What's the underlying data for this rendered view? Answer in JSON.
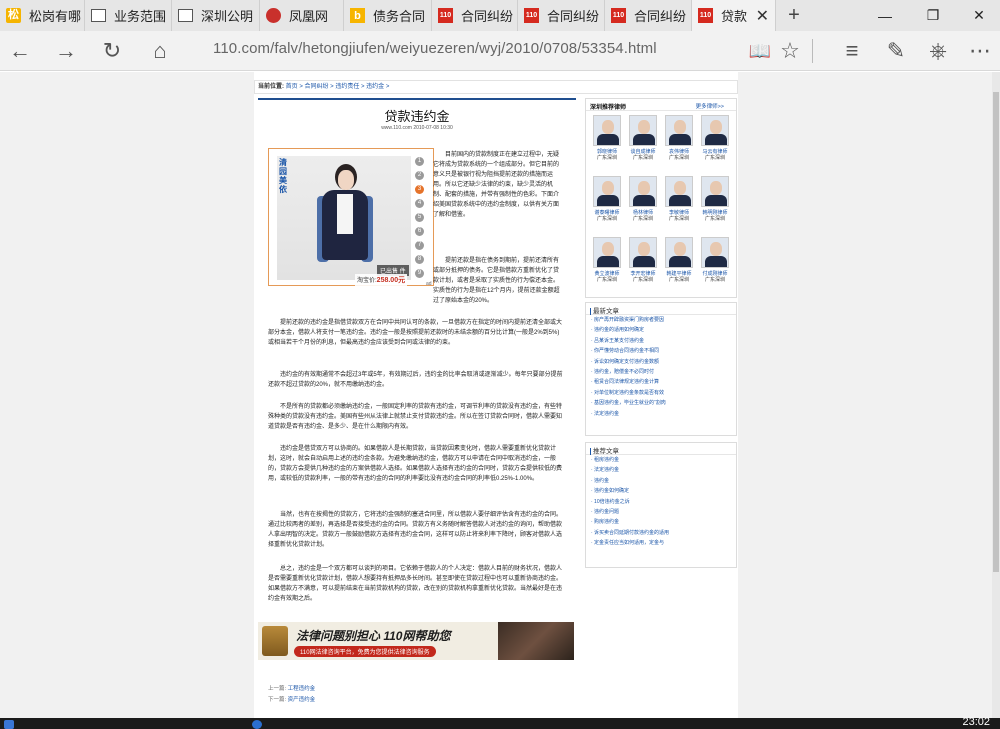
{
  "tabs": [
    {
      "title": "松岗有哪",
      "favicon": "orange-square"
    },
    {
      "title": "业务范围",
      "favicon": "page"
    },
    {
      "title": "深圳公明",
      "favicon": "page"
    },
    {
      "title": "凤凰网",
      "favicon": "phoenix"
    },
    {
      "title": "债务合同",
      "favicon": "bing"
    },
    {
      "title": "合同纠纷",
      "favicon": "110"
    },
    {
      "title": "合同纠纷",
      "favicon": "110"
    },
    {
      "title": "合同纠纷",
      "favicon": "110"
    },
    {
      "title": "贷款",
      "favicon": "110",
      "active": true
    }
  ],
  "favicon_text": {
    "orange": "松",
    "bing": "b",
    "site": "110"
  },
  "address": "110.com/falv/hetongjiufen/weiyuezeren/wyj/2010/0708/53354.html",
  "breadcrumb": {
    "label": "当前位置:",
    "path": "首页 > 合同纠纷 > 违约责任 > 违约金 >"
  },
  "article": {
    "title": "贷款违约金",
    "meta": "www.110.com 2010-07-08 10:30",
    "ad": {
      "vertical_text": "清园美依",
      "sold": "已出售 件",
      "price_label": "淘宝价:",
      "price": "258.00元",
      "numbers": [
        "1",
        "2",
        "3",
        "4",
        "5",
        "6",
        "7",
        "8",
        "9"
      ],
      "active_index": 2,
      "corner": "ad"
    },
    "paragraphs": [
      "目前国内的贷款制度正在建立过程中，无疑它将成为贷款系统的一个组成部分。但它目前的意义只是被银行视为阻挡提前还款的措施而运用。所以它还缺少法律的约束，缺少灵活的机制、配套的措施，并带有强制性的色彩。下面介绍美国贷款系统中的违约金制度，以供有关方面了解和借鉴。",
      "提前还款是指在债务到期前，提前还清所有或部分抵押的债务。它是指借款方重新优化了贷款计划，或者是采取了实质性的行为偿还本金。实质性的行为是指在12个月内，提前还款金额超过了原始本金的20%。",
      "提前还款的违约金是指借贷款双方在合同中共同认可的条款，一旦借款方在指定的时间内提前还清全部或大部分本金，借款人将支付一笔违约金。违约金一般是按照提前还款时的未结余额的百分比计算(一般是2%到5%)或相当若干个月份的利息，但最高违约金应该受到合同或法律的约束。",
      "违约金的有效期通常不会超过3年或5年，有效期过后，违约金的比率会取消或逐渐减少。每年只要部分提前还款不超过贷款的20%，就不用缴纳违约金。",
      "不是所有的贷款都必须缴纳违约金，一般固定利率的贷款有违约金，可调节利率的贷款没有违约金，有些特殊种类的贷款没有违约金。美国有些州从法律上就禁止支付贷款违约金。所以在签订贷款合同时，借款人需要知道贷款是否有违约金、是多少、是在什么期限内有效。",
      "违约金是借贷双方可以协商的。如果借款人是长期贷款，当贷款因素变化时，借款人需要重新优化贷款计划，这时，就会自动启用上述的违约金条款。为避免缴纳违约金，借款方可以申请在合同中取消违约金，一般的，贷款方会提供几种违约金的方案供借款人选择。如果借款人选择有违约金的合同时，贷款方会提供较低的费用，或较低的贷款利率，一般的带有违约金的合同的利率要比没有违约金合同的利率低0.25%-1.00%。",
      "当然，也有在按揭性的贷款方，它将违约金强制的塞进合同里，所以借款人要仔细评估含有违约金的合同。通过比较两者的差别，再选择是否接受违约金的合同。贷款方有义务随时解答借款人对违约金的询问，帮助借款人拿出明智的决定。贷款方一般鼓励借款方选择有违约金合同，这样可以防止将来利率下降时，顾客对借款人选择重新优化贷款计划。",
      "总之，违约金是一个双方都可以谈判的项目。它依赖于借款人的个人决定：借款人目前的财务状况，借款人是否需要重新优化贷款计划，借款人想要持有抵押品多长时间。甚至即使在贷款过程中也可以重新协商违约金。如果借款方不满意，可以提前结束在当前贷款机构的贷款，改在别的贷款机构拿重新优化贷款。当然最好是在违约金有效期之后。"
    ]
  },
  "banner": {
    "title": "法律问题别担心 110网帮助您",
    "subtitle": "110网法律咨询平台，免费为您提供法律咨询服务"
  },
  "prevnext": {
    "prev_label": "上一篇:",
    "prev": "工程违约金",
    "next_label": "下一篇:",
    "next": "资产违约金"
  },
  "sidebar": {
    "lawyers_title": "深圳推荐律师",
    "lawyers_more": "更多律师>>",
    "lawyers": [
      {
        "name": "郭晓律师",
        "city": "广东深圳"
      },
      {
        "name": "谈自成律师",
        "city": "广东深圳"
      },
      {
        "name": "袁伟律师",
        "city": "广东深圳"
      },
      {
        "name": "马云有律师",
        "city": "广东深圳"
      },
      {
        "name": "谢泰曙律师",
        "city": "广东深圳"
      },
      {
        "name": "杨林律师",
        "city": "广东深圳"
      },
      {
        "name": "李敏律师",
        "city": "广东深圳"
      },
      {
        "name": "韩明刚律师",
        "city": "广东深圳"
      },
      {
        "name": "黄立波律师",
        "city": "广东深圳"
      },
      {
        "name": "李开宏律师",
        "city": "广东深圳"
      },
      {
        "name": "韩建平律师",
        "city": "广东深圳"
      },
      {
        "name": "付成刚律师",
        "city": "广东深圳"
      }
    ],
    "latest_title": "最新文章",
    "latest": [
      "房产再开辟融资渠门购房者要因",
      "违约金的适用如何确定",
      "吕某诉王某支付违约金",
      "你严懂劳动合同违约金不相同",
      "诉讼如何确定支付违约金数额",
      "违约金，赔偿金不必同时付",
      "租赁合同法律规定违约金计算",
      "对单位制定违约金条款是否有效",
      "基因违约金，毕业生就业的“割肉",
      "法定违约金"
    ],
    "recommended_title": "推荐文章",
    "recommended": [
      "租房违约金",
      "法定违约金",
      "违约金",
      "违约金如何确定",
      "10倍违约金之诉",
      "违约金问题",
      "购房违约金",
      "诉买卖合同延期付款违约金的适用",
      "定金责任应当如何适用，定金与"
    ]
  },
  "taskbar": {
    "clock": "23:02"
  }
}
